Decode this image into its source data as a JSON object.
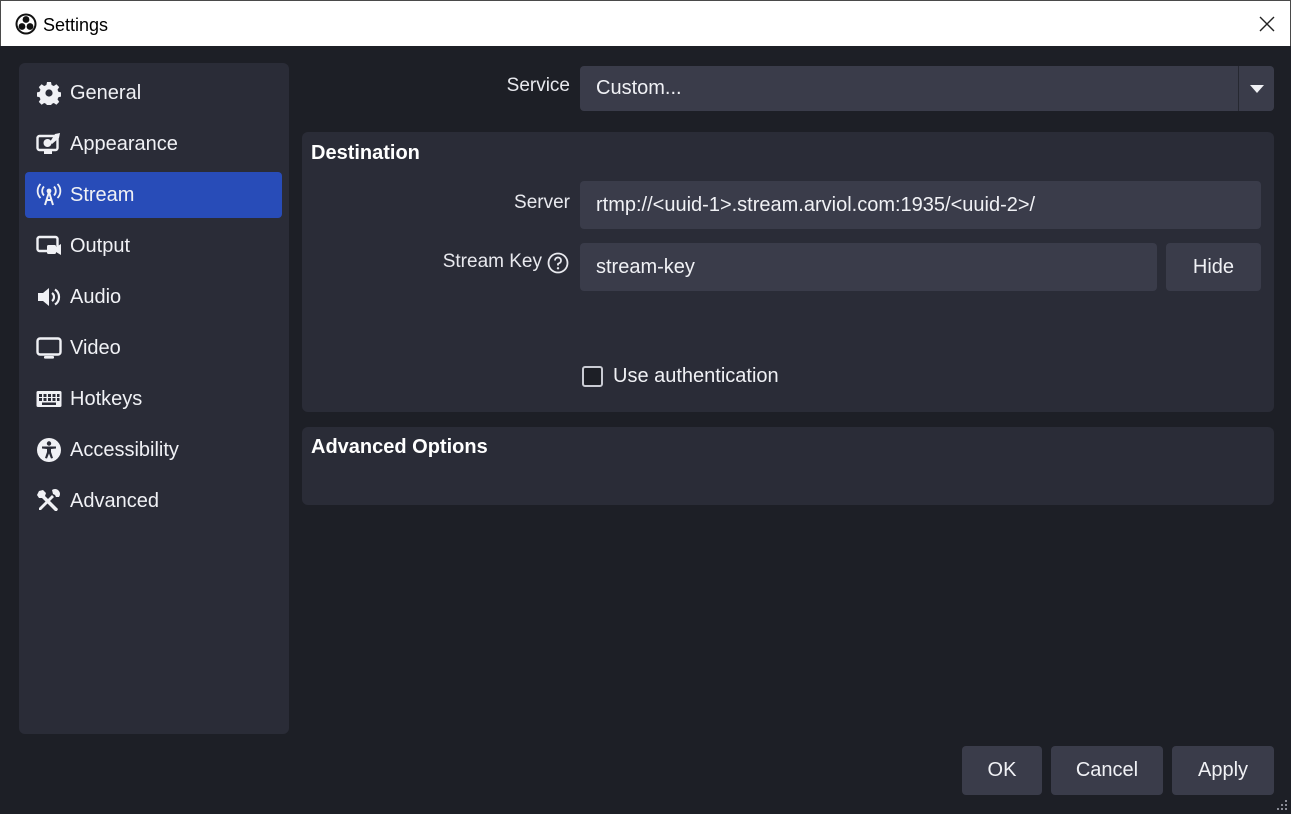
{
  "window": {
    "title": "Settings",
    "close_icon": "close-icon",
    "app_icon": "obs-logo-icon"
  },
  "sidebar": {
    "items": [
      {
        "label": "General",
        "icon": "gear-icon",
        "active": false
      },
      {
        "label": "Appearance",
        "icon": "appearance-icon",
        "active": false
      },
      {
        "label": "Stream",
        "icon": "antenna-icon",
        "active": true
      },
      {
        "label": "Output",
        "icon": "output-icon",
        "active": false
      },
      {
        "label": "Audio",
        "icon": "speaker-icon",
        "active": false
      },
      {
        "label": "Video",
        "icon": "monitor-icon",
        "active": false
      },
      {
        "label": "Hotkeys",
        "icon": "keyboard-icon",
        "active": false
      },
      {
        "label": "Accessibility",
        "icon": "accessibility-icon",
        "active": false
      },
      {
        "label": "Advanced",
        "icon": "tools-icon",
        "active": false
      }
    ]
  },
  "service": {
    "label": "Service",
    "value": "Custom..."
  },
  "destination": {
    "title": "Destination",
    "server_label": "Server",
    "server_value": "rtmp://<uuid-1>.stream.arviol.com:1935/<uuid-2>/",
    "stream_key_label": "Stream Key",
    "stream_key_value": "stream-key",
    "hide_button": "Hide",
    "use_auth_label": "Use authentication",
    "use_auth_checked": false
  },
  "advanced_options": {
    "title": "Advanced Options"
  },
  "footer": {
    "ok": "OK",
    "cancel": "Cancel",
    "apply": "Apply"
  },
  "colors": {
    "background": "#1d1f26",
    "panel": "#2a2c37",
    "input": "#3a3c4a",
    "accent": "#284cb8"
  }
}
